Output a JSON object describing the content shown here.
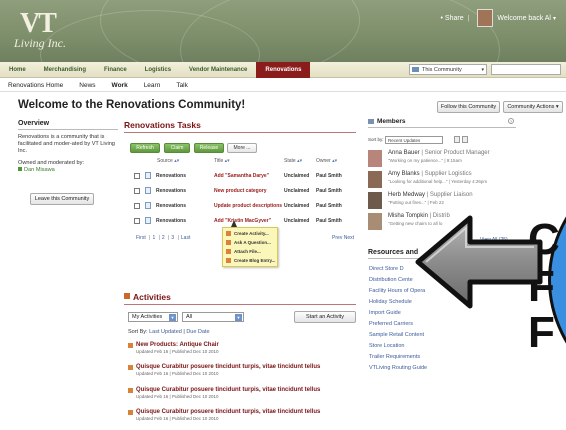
{
  "header": {
    "logo_main": "VT",
    "logo_sub": "Living Inc.",
    "share": "• Share",
    "welcome": "Welcome back Al",
    "caret": "▾"
  },
  "mainnav": {
    "items": [
      "Home",
      "Merchandising",
      "Finance",
      "Logistics",
      "Vendor Maintenance",
      "Renovations"
    ],
    "community_select": "This Community"
  },
  "subnav": [
    "Renovations Home",
    "News",
    "Work",
    "Learn",
    "Talk"
  ],
  "page_title": "Welcome to the Renovations Community!",
  "buttons": {
    "follow": "Follow this Community",
    "actions": "Community Actions ▾"
  },
  "overview": {
    "heading": "Overview",
    "text": "Renovations is a community that is facilitated and moder-ated by VT Living Inc.",
    "owned_label": "Owned and moderated by:",
    "owner": "Dan Misawa",
    "leave": "Leave this Community"
  },
  "tasks": {
    "heading": "Renovations Tasks",
    "toolbar": [
      "Refresh",
      "Claim",
      "Release",
      "More ..."
    ],
    "columns": [
      "Source",
      "Title",
      "State",
      "Owner"
    ],
    "rows": [
      {
        "source": "Renovations",
        "title": "Add \"Samantha Darye\"",
        "state": "Unclaimed",
        "owner": "Paul Smith"
      },
      {
        "source": "Renovations",
        "title": "New product category",
        "state": "Unclaimed",
        "owner": "Paul Smith"
      },
      {
        "source": "Renovations",
        "title": "Update product descriptions",
        "state": "Unclaimed",
        "owner": "Paul Smith"
      },
      {
        "source": "Renovations",
        "title": "Add \"Kristin MacGyver\"",
        "state": "Unclaimed",
        "owner": "Paul Smith"
      }
    ],
    "pager": {
      "first": "First",
      "p1": "1",
      "p2": "2",
      "p3": "3",
      "last": "Last",
      "prev_next": "Prev Next"
    },
    "menu": [
      "Create Activity...",
      "Ask A Question...",
      "Attach File...",
      "Create Blog Entry..."
    ]
  },
  "activities": {
    "heading": "Activities",
    "filter1": "My Activities",
    "filter2": "All",
    "start": "Start an Activity",
    "sort_label": "Sort By:",
    "sort_updated": "Last Updated",
    "sort_due": "Due Date",
    "items": [
      {
        "title": "New Products: Antique Chair",
        "meta": "Updated Feb 16  |  Published Dec 10 2010"
      },
      {
        "title": "Quisque Curabitur posuere tincidunt turpis, vitae tincidunt tellus",
        "meta": "Updated Feb 16  |  Published Dec 10 2010"
      },
      {
        "title": "Quisque Curabitur posuere tincidunt turpis, vitae tincidunt tellus",
        "meta": "Updated Feb 16  |  Published Dec 10 2010"
      },
      {
        "title": "Quisque Curabitur posuere tincidunt turpis, vitae tincidunt tellus",
        "meta": "Updated Feb 16  |  Published Dec 10 2010"
      }
    ]
  },
  "members": {
    "heading": "Members",
    "help": "?",
    "sort_label": "Sort by:",
    "sort_value": "Recent Updates",
    "list": [
      {
        "name": "Anna Bauer",
        "role": " |  Senior Product Manager",
        "status": "\"Working on my patience...\" | 9:15am"
      },
      {
        "name": "Amy Blanks",
        "role": " |  Supplier Logistics",
        "status": "\"Looking for additional help...\" | Yesterday 4:26pm"
      },
      {
        "name": "Herb Medway",
        "role": " |  Supplier Liaison",
        "status": "\"Putting out fires...\" | Feb 22"
      },
      {
        "name": "Misha Tompkin",
        "role": " |  Distrib",
        "status": "\"Getting new chairs to all lo"
      }
    ],
    "view_all": "View All (25)"
  },
  "resources": {
    "heading": "Resources and",
    "links": [
      "Direct Store D",
      "Distribution Cente",
      "Facility Hours of Opera",
      "Holiday Schedule",
      "Import Guide",
      "Preferred Carriers",
      "Sample Retail Content",
      "Store Location",
      "Trailer Requirements",
      "VTLiving Routing Guide"
    ]
  },
  "overlay": {
    "letters": [
      "C",
      "F",
      "F"
    ]
  },
  "colors": {
    "accent": "#8a1c1c",
    "header": "#7d8e6a",
    "green_button": "#5e9a3c",
    "link": "#3b5b9b",
    "overlay_blue": "#3a8fe0"
  }
}
